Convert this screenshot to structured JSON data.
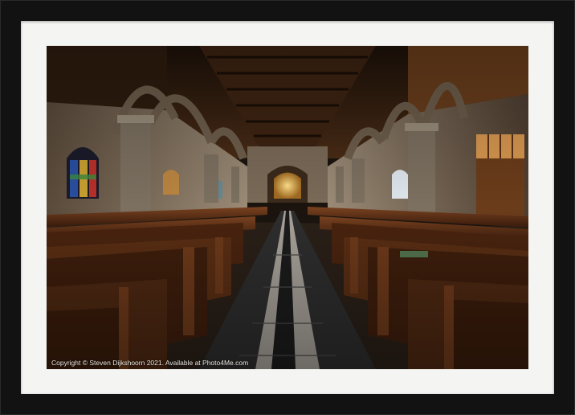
{
  "image": {
    "subject": "church-interior",
    "colors": {
      "frame": "#121212",
      "mat": "#f4f4f2",
      "wood": "#5a2f16",
      "stone": "#8a7a68",
      "ceiling": "#2a1a0f",
      "floor_dark": "#2e2e2e",
      "floor_light": "#a8a29a",
      "stained_glass_blue": "#2a4fa0",
      "stained_glass_red": "#b8302a",
      "altar_glow": "#e8b840"
    }
  },
  "credit": {
    "text": "Copyright © Steven Dijkshoorn 2021. Available at Photo4Me.com"
  }
}
